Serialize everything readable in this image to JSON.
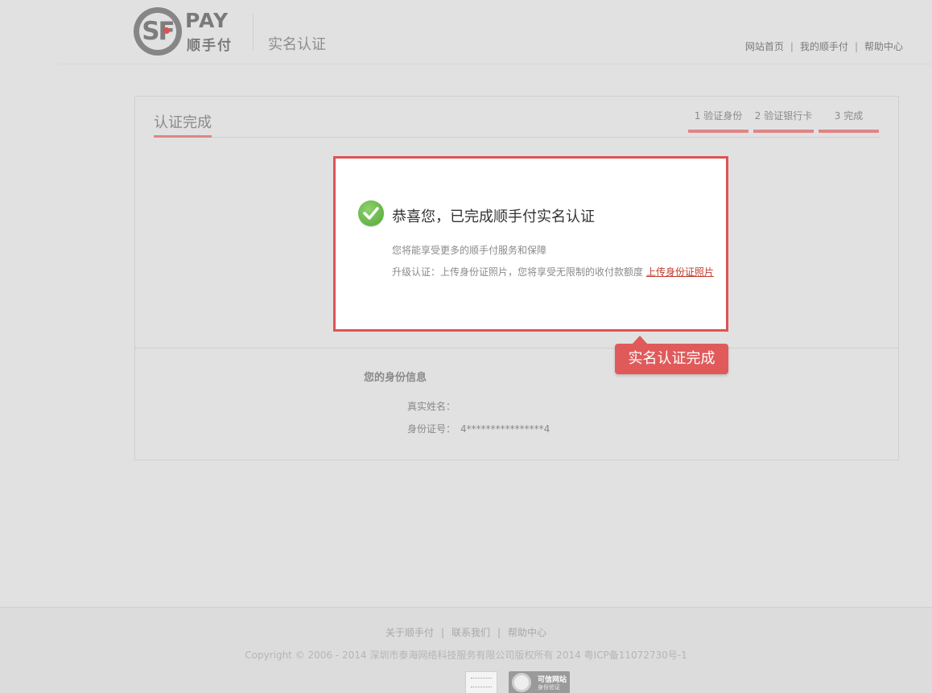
{
  "header": {
    "logo_pay": "PAY",
    "logo_cn": "顺手付",
    "page_title": "实名认证",
    "nav": [
      "网站首页",
      "我的顺手付",
      "帮助中心"
    ]
  },
  "panel": {
    "title": "认证完成",
    "steps": [
      "1 验证身份",
      "2 验证银行卡",
      "3 完成"
    ]
  },
  "success": {
    "title": "恭喜您，已完成顺手付实名认证",
    "subtitle": "您将能享受更多的顺手付服务和保障",
    "upgrade_text": "升级认证：上传身份证照片，您将享受无限制的收付款额度",
    "upload_link": "上传身份证照片"
  },
  "callout": "实名认证完成",
  "identity": {
    "title": "您的身份信息",
    "name_label": "真实姓名：",
    "name_value": "",
    "id_label": "身份证号：",
    "id_value": "4****************4"
  },
  "footer": {
    "links": [
      "关于顺手付",
      "联系我们",
      "帮助中心"
    ],
    "copyright": "Copyright © 2006 - 2014 深圳市泰海网络科技服务有限公司版权所有 2014 粤ICP备11072730号-1",
    "badge_title": "可信网站",
    "badge_sub": "身份验证"
  },
  "colors": {
    "accent": "#de5353",
    "step_bar": "#e08585",
    "success_green": "#4fa833"
  }
}
